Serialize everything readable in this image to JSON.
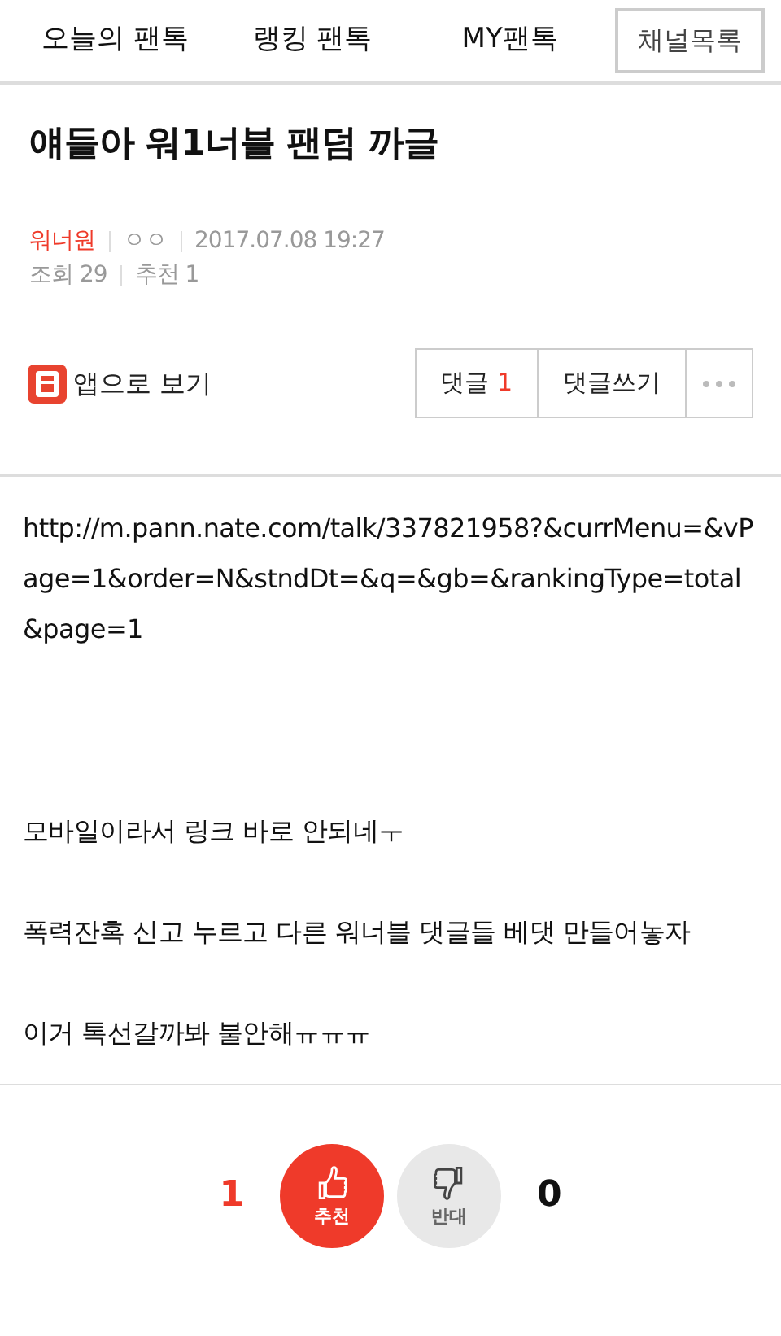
{
  "top_nav": {
    "tabs": [
      {
        "label": "오늘의 팬톡"
      },
      {
        "label": "랭킹 팬톡"
      },
      {
        "label": "MY팬톡"
      }
    ],
    "channel_button": "채널목록"
  },
  "post": {
    "title": "얘들아 워1너블 팬덤 까글",
    "channel": "워너원",
    "author": "ㅇㅇ",
    "datetime": "2017.07.08 19:27",
    "views_label": "조회",
    "views": "29",
    "recommends_label": "추천",
    "recommends": "1"
  },
  "actions": {
    "app_link": "앱으로 보기",
    "comment_button": "댓글",
    "comment_count": "1",
    "write_button": "댓글쓰기"
  },
  "body": [
    {
      "kind": "url",
      "text": "http://m.pann.nate.com/talk/337821958?&currMenu=&vPage=1&order=N&stndDt=&q=&gb=&rankingType=total&page=1"
    },
    {
      "kind": "text",
      "text": "모바일이라서 링크 바로 안되네ㅜ"
    },
    {
      "kind": "text",
      "text": "폭력잔혹 신고 누르고 다른 워너블 댓글들 베댓 만들어놓자"
    },
    {
      "kind": "text",
      "text": "이거 톡선갈까봐 불안해ㅠㅠㅠ"
    }
  ],
  "votes": [
    {
      "kind": "up",
      "count": "1",
      "label": "추천"
    },
    {
      "kind": "down",
      "count": "0",
      "label": "반대"
    }
  ]
}
